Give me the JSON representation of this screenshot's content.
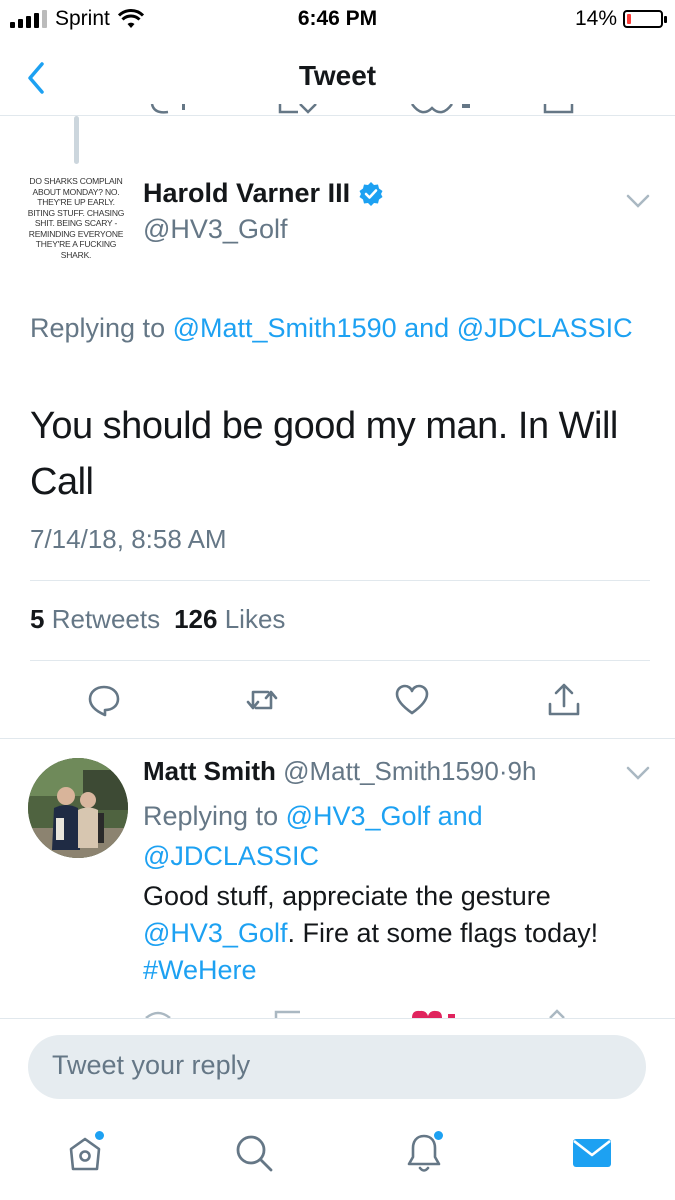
{
  "status_bar": {
    "carrier": "Sprint",
    "time": "6:46 PM",
    "battery_percent": "14%",
    "battery_level": 0.14,
    "battery_color": "#fc3d39"
  },
  "nav": {
    "title": "Tweet",
    "back_icon": "chevron-left-icon"
  },
  "main_tweet": {
    "avatar_text": "DO SHARKS COMPLAIN ABOUT MONDAY? NO. THEY'RE UP EARLY. BITING STUFF. CHASING SHIT. BEING SCARY - REMINDING EVERYONE THEY'RE A FUCKING SHARK.",
    "author_name": "Harold Varner III",
    "verified": true,
    "handle": "@HV3_Golf",
    "replying_prefix": "Replying to",
    "replying_user1": "@Matt_Smith1590",
    "replying_and": "and",
    "replying_user2": "@JDCLASSIC",
    "text": "You should be good my man. In Will Call",
    "date": "7/14/18, 8:58 AM",
    "retweets_count": "5",
    "retweets_label": "Retweets",
    "likes_count": "126",
    "likes_label": "Likes"
  },
  "reply_tweet": {
    "author_name": "Matt Smith",
    "handle": "@Matt_Smith1590",
    "separator": "·",
    "time_ago": "9h",
    "replying_prefix": "Replying to",
    "replying_user1": "@HV3_Golf",
    "replying_and": "and",
    "replying_user2": "@JDCLASSIC",
    "text_part1": "Good stuff, appreciate the gesture",
    "text_mention": "@HV3_Golf",
    "text_part2": ". Fire at some flags today!",
    "hashtag": "#WeHere"
  },
  "compose": {
    "placeholder": "Tweet your reply"
  },
  "colors": {
    "accent": "#1da1f2",
    "secondary_text": "#657786",
    "primary_text": "#14171a",
    "like_red": "#e0245e"
  }
}
